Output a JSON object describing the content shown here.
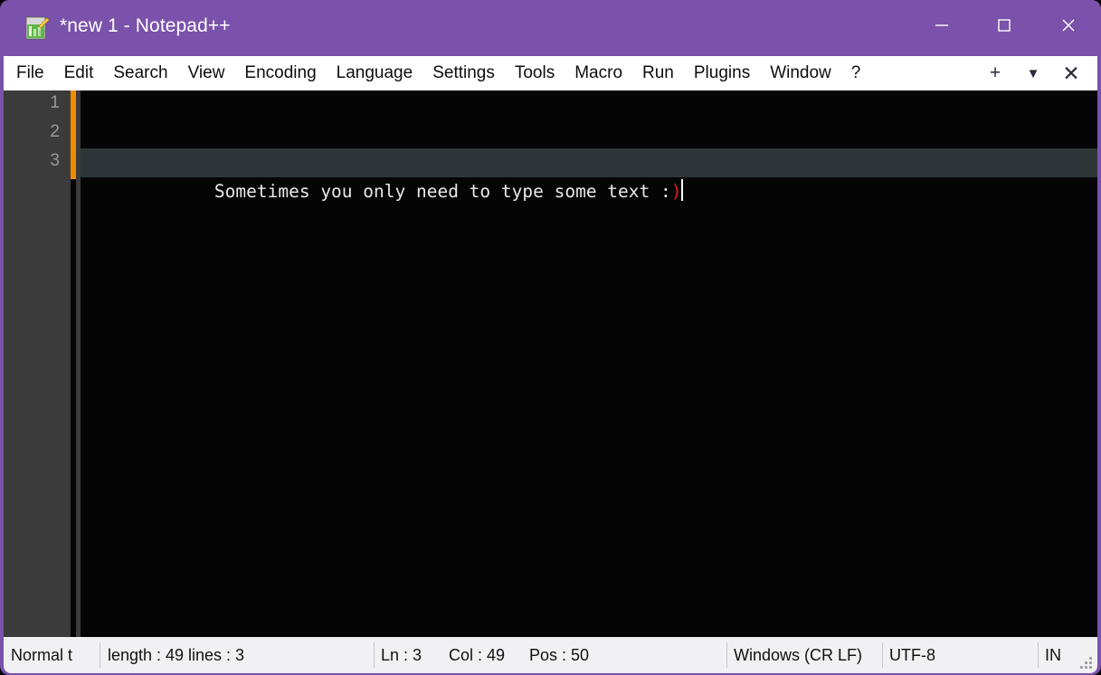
{
  "window": {
    "title": "*new 1 - Notepad++",
    "accent_color": "#7a52ab",
    "icon": "notepad-plus-plus-document-icon",
    "controls": {
      "minimize": "minimize-icon",
      "maximize": "maximize-icon",
      "close": "close-icon"
    }
  },
  "menubar": {
    "items": [
      {
        "label": "File"
      },
      {
        "label": "Edit"
      },
      {
        "label": "Search"
      },
      {
        "label": "View"
      },
      {
        "label": "Encoding"
      },
      {
        "label": "Language"
      },
      {
        "label": "Settings"
      },
      {
        "label": "Tools"
      },
      {
        "label": "Macro"
      },
      {
        "label": "Run"
      },
      {
        "label": "Plugins"
      },
      {
        "label": "Window"
      },
      {
        "label": "?"
      }
    ],
    "controls": {
      "new_tab": "+",
      "tab_list": "▼",
      "close_tab": "✕"
    }
  },
  "editor": {
    "background_color": "#050505",
    "gutter_color": "#3b3b3b",
    "current_line_color": "#2c3538",
    "change_marker_color": "#f08c00",
    "line_numbers": [
      "1",
      "2",
      "3"
    ],
    "lines": [
      {
        "number": "1",
        "text": "",
        "current": false
      },
      {
        "number": "2",
        "text": "",
        "current": false
      },
      {
        "number": "3",
        "text": "Sometimes you only need to type some text :",
        "tail": ")",
        "tail_color": "#e01b1b",
        "current": true
      }
    ]
  },
  "statusbar": {
    "file_type": "Normal t",
    "length": "length : 49",
    "lines": "lines : 3",
    "ln": "Ln : 3",
    "col": "Col : 49",
    "pos": "Pos : 50",
    "eol": "Windows (CR LF)",
    "encoding": "UTF-8",
    "insert_mode": "IN"
  }
}
